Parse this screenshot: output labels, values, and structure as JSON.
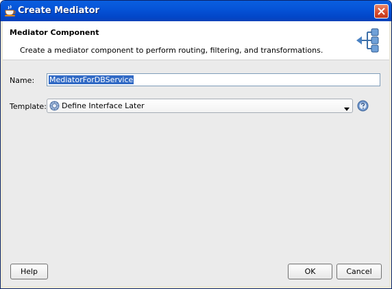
{
  "window": {
    "title": "Create Mediator"
  },
  "header": {
    "title": "Mediator Component",
    "description": "Create a mediator component to perform routing, filtering, and transformations."
  },
  "form": {
    "name_label": "Name:",
    "name_value": "MediatorForDBService",
    "template_label": "Template:",
    "template_value": "Define Interface Later"
  },
  "buttons": {
    "help": "Help",
    "ok": "OK",
    "cancel": "Cancel"
  },
  "icons": {
    "app": "coffee-cup-icon",
    "close": "close-icon",
    "header": "mediator-routing-icon",
    "template": "gear-icon",
    "dropdown": "chevron-down-icon",
    "help": "help-icon"
  },
  "colors": {
    "titlebar": "#0552d6",
    "close": "#d6492a",
    "selection": "#316ac5",
    "dialog_bg": "#ebebeb"
  }
}
